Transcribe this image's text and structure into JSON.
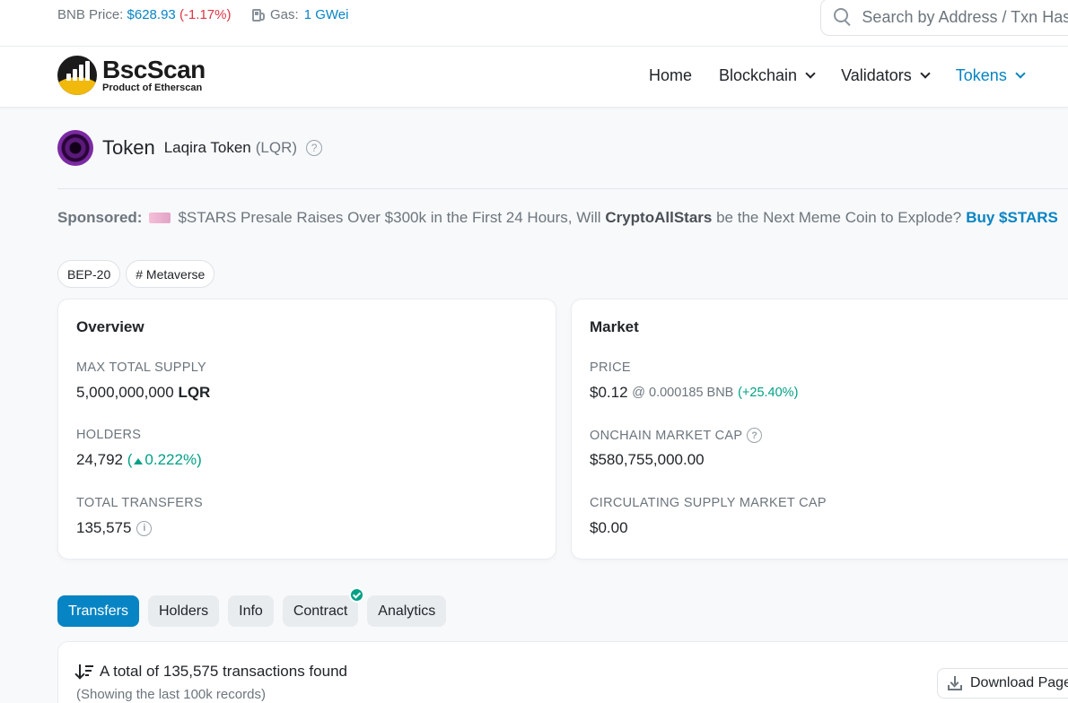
{
  "topbar": {
    "bnb_price_label": "BNB Price:",
    "bnb_price_value": "$628.93",
    "bnb_price_change": "(-1.17%)",
    "gas_label": "Gas:",
    "gas_value": "1 GWei",
    "search_placeholder": "Search by Address / Txn Hash / Block / Token / Domain Name"
  },
  "header": {
    "logo_name": "BscScan",
    "logo_sub": "Product of Etherscan",
    "nav": [
      {
        "label": "Home"
      },
      {
        "label": "Blockchain"
      },
      {
        "label": "Validators"
      },
      {
        "label": "Tokens"
      }
    ]
  },
  "token": {
    "title": "Token",
    "name": "Laqira Token",
    "symbol": "(LQR)"
  },
  "sponsored": {
    "label": "Sponsored:",
    "text_before": "$STARS Presale Raises Over $300k in the First 24 Hours, Will",
    "text_bold": "CryptoAllStars",
    "text_after": "be the Next Meme Coin to Explode?",
    "cta": "Buy $STARS"
  },
  "badges": [
    {
      "label": "BEP-20"
    },
    {
      "label": "# Metaverse"
    }
  ],
  "overview": {
    "title": "Overview",
    "max_supply_label": "MAX TOTAL SUPPLY",
    "max_supply_value": "5,000,000,000",
    "max_supply_symbol": "LQR",
    "holders_label": "HOLDERS",
    "holders_value": "24,792",
    "holders_change_open": "(",
    "holders_change": "0.222%)",
    "transfers_label": "TOTAL TRANSFERS",
    "transfers_value": "135,575"
  },
  "market": {
    "title": "Market",
    "price_label": "PRICE",
    "price_value": "$0.12",
    "price_bnb": "@ 0.000185 BNB",
    "price_change": "(+25.40%)",
    "mcap_label": "ONCHAIN MARKET CAP",
    "mcap_value": "$580,755,000.00",
    "circ_label": "CIRCULATING SUPPLY MARKET CAP",
    "circ_value": "$0.00"
  },
  "tabs": [
    {
      "label": "Transfers",
      "active": true
    },
    {
      "label": "Holders"
    },
    {
      "label": "Info"
    },
    {
      "label": "Contract",
      "verified": true
    },
    {
      "label": "Analytics"
    }
  ],
  "transfers_panel": {
    "total_text": "A total of 135,575 transactions found",
    "sub_text": "(Showing the last 100k records)",
    "download_label": "Download Page Data"
  },
  "colors": {
    "accent": "#0784c3",
    "positive": "#00a186",
    "negative": "#dc3545",
    "brand_yellow": "#f0b90b"
  }
}
